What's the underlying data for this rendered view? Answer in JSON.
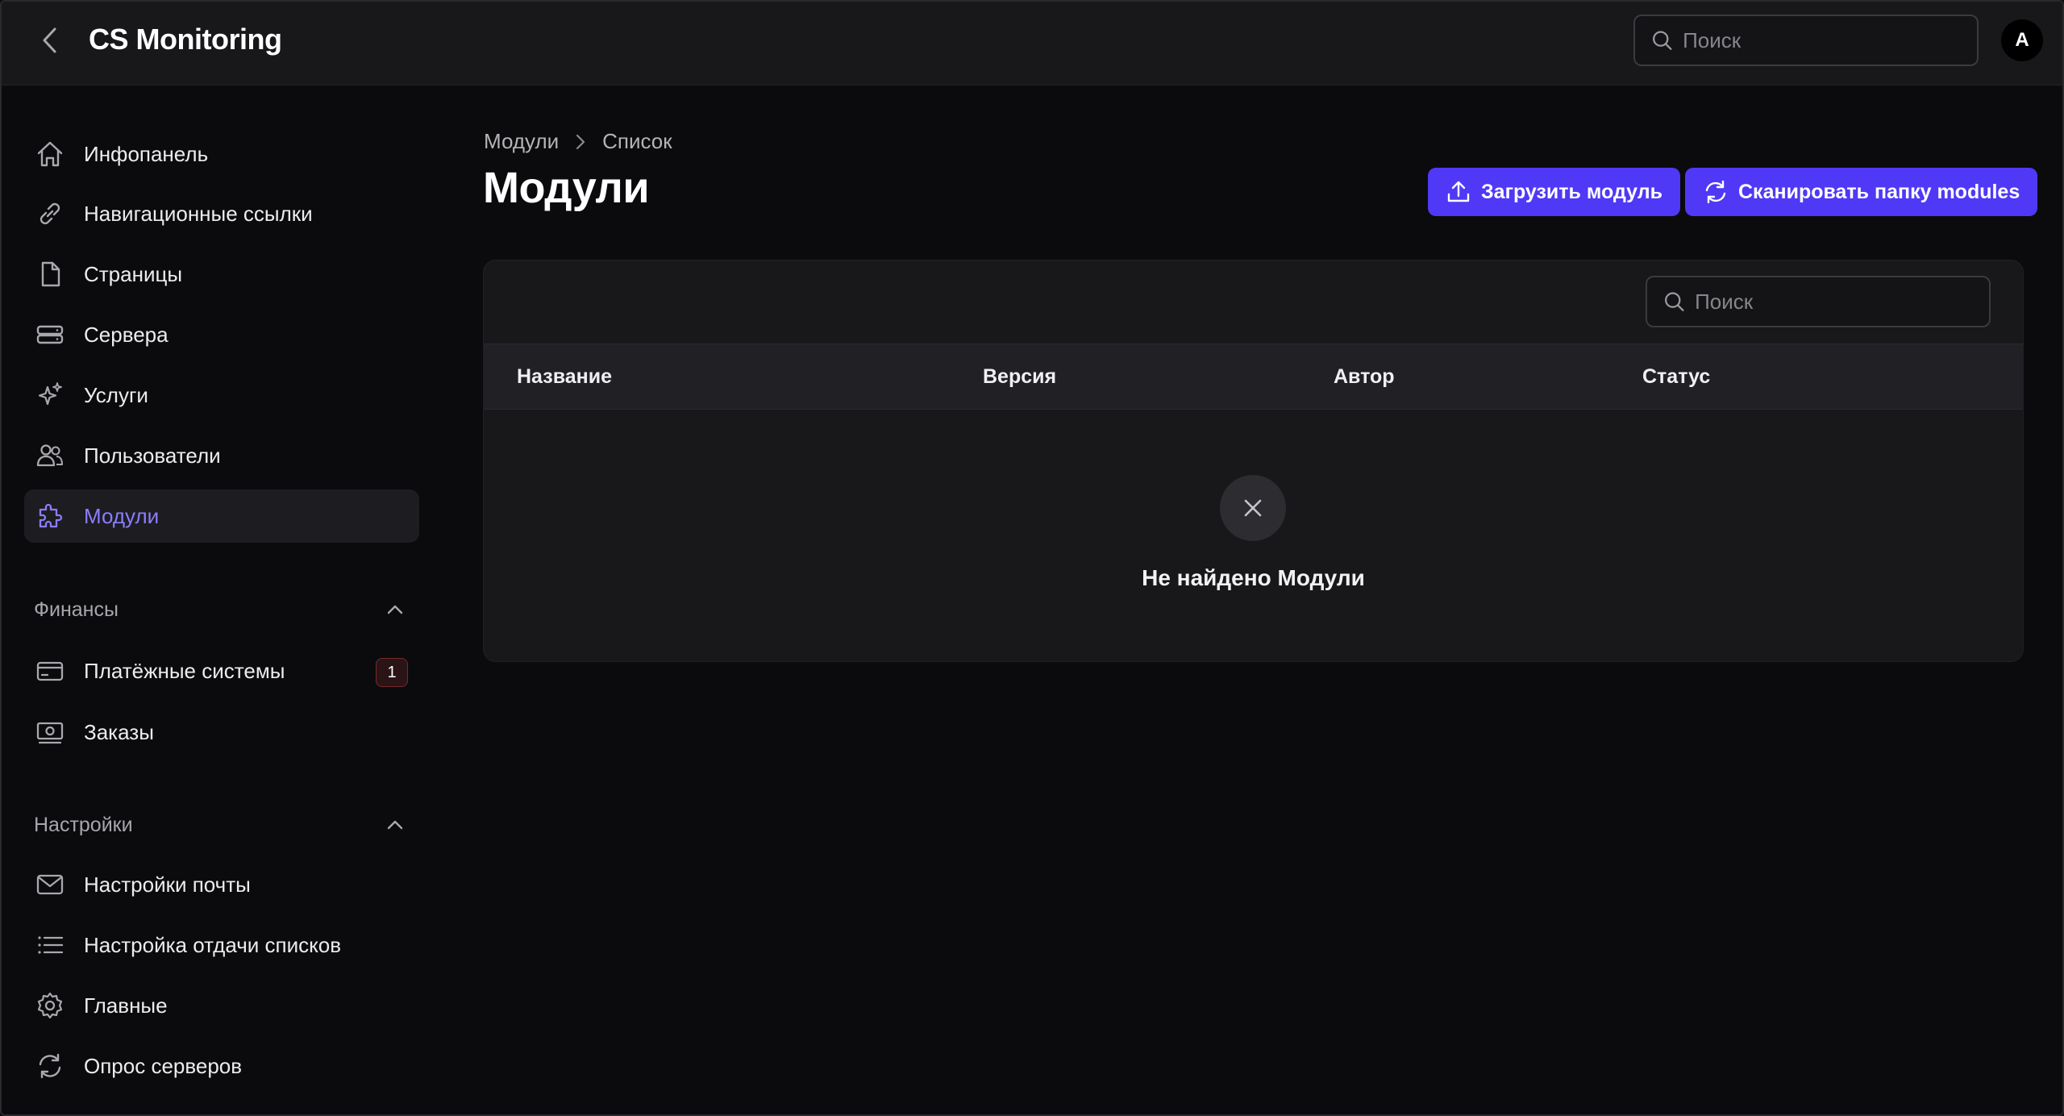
{
  "header": {
    "app_title": "CS Monitoring",
    "search_placeholder": "Поиск",
    "avatar_letter": "A"
  },
  "sidebar": {
    "items": [
      {
        "label": "Инфопанель",
        "icon": "home-icon"
      },
      {
        "label": "Навигационные ссылки",
        "icon": "link-icon"
      },
      {
        "label": "Страницы",
        "icon": "document-icon"
      },
      {
        "label": "Сервера",
        "icon": "server-icon"
      },
      {
        "label": "Услуги",
        "icon": "sparkles-icon"
      },
      {
        "label": "Пользователи",
        "icon": "users-icon"
      },
      {
        "label": "Модули",
        "icon": "puzzle-icon",
        "active": true
      }
    ],
    "finance": {
      "title": "Финансы",
      "items": [
        {
          "label": "Платёжные системы",
          "icon": "credit-card-icon",
          "badge": "1"
        },
        {
          "label": "Заказы",
          "icon": "banknote-icon"
        }
      ]
    },
    "settings": {
      "title": "Настройки",
      "items": [
        {
          "label": "Настройки почты",
          "icon": "mail-icon"
        },
        {
          "label": "Настройка отдачи списков",
          "icon": "list-icon"
        },
        {
          "label": "Главные",
          "icon": "gear-icon"
        },
        {
          "label": "Опрос серверов",
          "icon": "refresh-icon"
        }
      ]
    }
  },
  "main": {
    "breadcrumb": [
      "Модули",
      "Список"
    ],
    "title": "Модули",
    "upload_button": "Загрузить модуль",
    "scan_button": "Сканировать папку modules",
    "table": {
      "search_placeholder": "Поиск",
      "columns": [
        "Название",
        "Версия",
        "Автор",
        "Статус"
      ],
      "empty_text": "Не найдено Модули"
    }
  },
  "colors": {
    "accent": "#4f39f6",
    "active_label": "#8b7dff",
    "background": "#0b0b0d",
    "panel": "#18181b"
  }
}
